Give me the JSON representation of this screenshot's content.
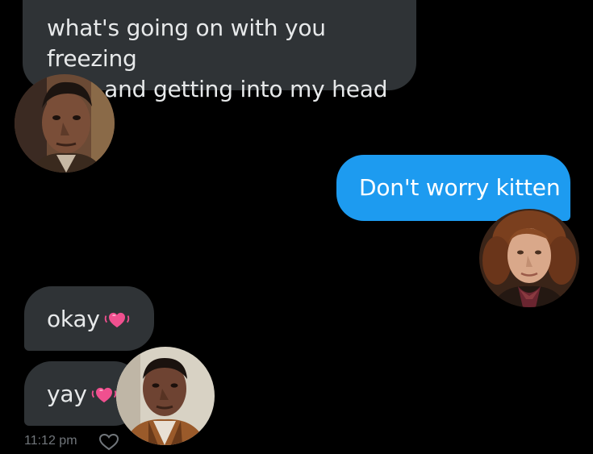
{
  "messages": [
    {
      "sender": "other",
      "text_line1": "what's going on with you freezing",
      "text_line2": "time and getting into my head"
    },
    {
      "sender": "self",
      "text": "Don't worry kitten"
    },
    {
      "sender": "other",
      "text": "okay",
      "emoji": "pink-heart"
    },
    {
      "sender": "other",
      "text": "yay",
      "emoji": "pink-heart"
    }
  ],
  "timestamp": "11:12 pm",
  "avatars": [
    {
      "icon": "dark-haired-man-portrait"
    },
    {
      "icon": "curly-haired-man-portrait"
    },
    {
      "icon": "dark-haired-man-portrait"
    }
  ],
  "colors": {
    "background": "#000000",
    "incoming_bubble": "#2f3336",
    "outgoing_bubble": "#1d9bf0",
    "heart": "#f0508f"
  }
}
